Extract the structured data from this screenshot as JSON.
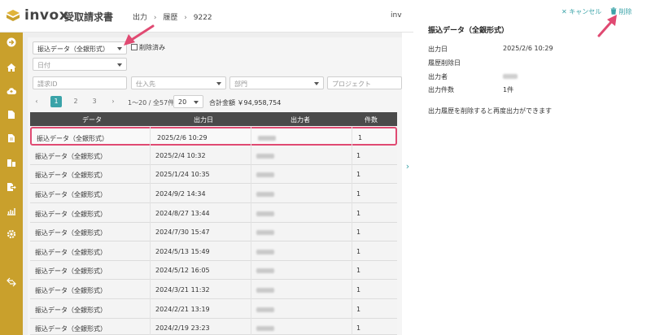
{
  "app": {
    "logo": "invox",
    "product": "受取請求書",
    "user_fragment": "inv"
  },
  "breadcrumb": [
    "出力",
    "履歴",
    "9222"
  ],
  "filters": {
    "format": "振込データ（全銀形式）",
    "deleted_label": "削除済み",
    "date": "日付",
    "invoice_id_placeholder": "請求ID",
    "supplier_placeholder": "仕入先",
    "dept_placeholder": "部門",
    "project_placeholder": "プロジェクト"
  },
  "pagination": {
    "prev": "‹",
    "pages": [
      "1",
      "2",
      "3"
    ],
    "next": "›",
    "range": "1〜20 / 全57件",
    "per_page": "20",
    "total": "合計金額 ￥94,958,754"
  },
  "table": {
    "headers": [
      "データ",
      "出力日",
      "出力者",
      "件数"
    ],
    "rows": [
      {
        "data": "振込データ（全銀形式）",
        "date": "2025/2/6 10:29",
        "count": "1"
      },
      {
        "data": "振込データ（全銀形式）",
        "date": "2025/2/4 10:32",
        "count": "1"
      },
      {
        "data": "振込データ（全銀形式）",
        "date": "2025/1/24 10:35",
        "count": "1"
      },
      {
        "data": "振込データ（全銀形式）",
        "date": "2024/9/2 14:34",
        "count": "1"
      },
      {
        "data": "振込データ（全銀形式）",
        "date": "2024/8/27 13:44",
        "count": "1"
      },
      {
        "data": "振込データ（全銀形式）",
        "date": "2024/7/30 15:47",
        "count": "1"
      },
      {
        "data": "振込データ（全銀形式）",
        "date": "2024/5/13 15:49",
        "count": "1"
      },
      {
        "data": "振込データ（全銀形式）",
        "date": "2024/5/12 16:05",
        "count": "1"
      },
      {
        "data": "振込データ（全銀形式）",
        "date": "2024/3/21 11:32",
        "count": "1"
      },
      {
        "data": "振込データ（全銀形式）",
        "date": "2024/2/21 13:19",
        "count": "1"
      },
      {
        "data": "振込データ（全銀形式）",
        "date": "2024/2/19 23:23",
        "count": "1"
      }
    ]
  },
  "detail": {
    "cancel": "キャンセル",
    "delete": "削除",
    "title": "振込データ（全銀形式）",
    "output_date_label": "出力日",
    "output_date": "2025/2/6 10:29",
    "deleted_date_label": "履歴削除日",
    "output_by_label": "出力者",
    "count_label": "出力件数",
    "count": "1件",
    "note": "出力履歴を削除すると再度出力ができます"
  },
  "colors": {
    "sidebar": "#c9a02c",
    "accent": "#3aa3a8",
    "highlight": "#e04a72"
  }
}
